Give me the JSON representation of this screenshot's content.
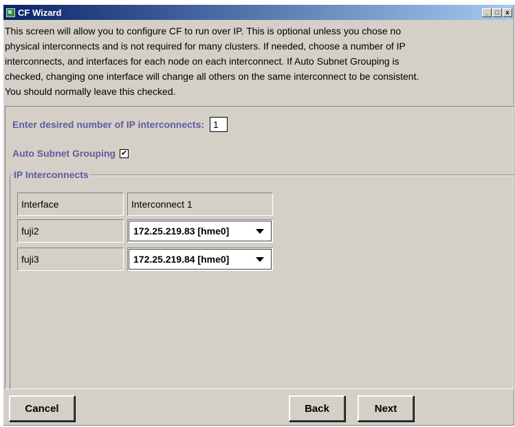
{
  "window": {
    "title": "CF Wizard",
    "controls": {
      "minimize": "_",
      "maximize": "□",
      "close": "x"
    }
  },
  "description": [
    "This screen will allow you to configure CF to run over IP.  This is optional unless you chose no",
    "physical interconnects and is not required for many clusters.  If needed, choose a number of IP",
    "interconnects, and interfaces for each node on each interconnect.  If Auto Subnet Grouping is",
    "checked, changing one interface will change all others on the same interconnect to be consistent.",
    "You should normally leave this checked."
  ],
  "form": {
    "num_label": "Enter desired number of IP interconnects:",
    "num_value": "1",
    "auto_label": "Auto Subnet Grouping",
    "auto_checked": "✔",
    "group_title": "IP Interconnects"
  },
  "table": {
    "headers": [
      "Interface",
      "Interconnect 1"
    ],
    "rows": [
      {
        "iface": "fuji2",
        "value": "172.25.219.83 [hme0]"
      },
      {
        "iface": "fuji3",
        "value": "172.25.219.84 [hme0]"
      }
    ]
  },
  "buttons": {
    "cancel": "Cancel",
    "back": "Back",
    "next": "Next"
  },
  "colors": {
    "title_start": "#0a246a",
    "title_end": "#a6caf0",
    "label": "#5c5ca0",
    "face": "#d4d0c8"
  }
}
